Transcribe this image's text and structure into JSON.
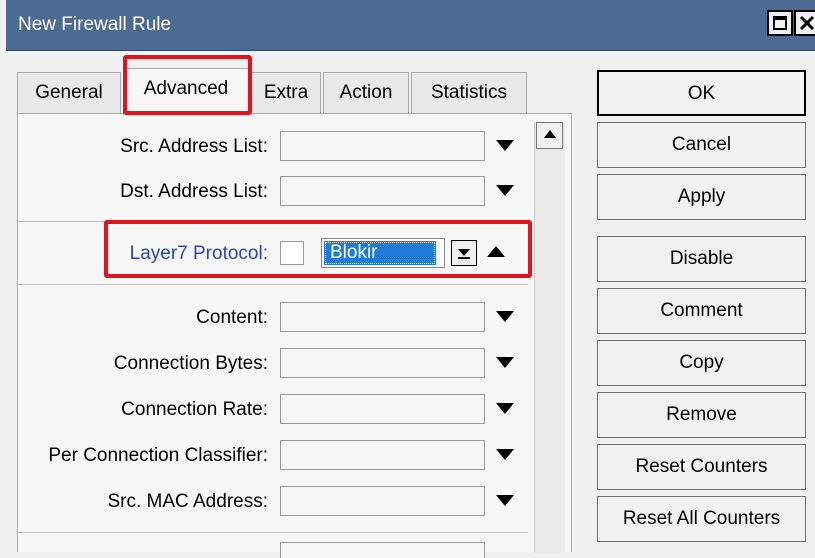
{
  "window": {
    "title": "New Firewall Rule"
  },
  "tabs": [
    {
      "label": "General"
    },
    {
      "label": "Advanced",
      "active": true
    },
    {
      "label": "Extra"
    },
    {
      "label": "Action"
    },
    {
      "label": "Statistics"
    }
  ],
  "fields": {
    "src_address_list": {
      "label": "Src. Address List:",
      "value": ""
    },
    "dst_address_list": {
      "label": "Dst. Address List:",
      "value": ""
    },
    "layer7": {
      "label": "Layer7 Protocol:",
      "value": "Blokir"
    },
    "content": {
      "label": "Content:",
      "value": ""
    },
    "connection_bytes": {
      "label": "Connection Bytes:",
      "value": ""
    },
    "connection_rate": {
      "label": "Connection Rate:",
      "value": ""
    },
    "per_connection_classifier": {
      "label": "Per Connection Classifier:",
      "value": ""
    },
    "src_mac_address": {
      "label": "Src. MAC Address:",
      "value": ""
    }
  },
  "buttons": {
    "ok": "OK",
    "cancel": "Cancel",
    "apply": "Apply",
    "disable": "Disable",
    "comment": "Comment",
    "copy": "Copy",
    "remove": "Remove",
    "reset_counters": "Reset Counters",
    "reset_all_counters": "Reset All Counters"
  },
  "colors": {
    "titlebar": "#4c6b93",
    "highlight": "#e0141e",
    "selection": "#1f7ad8",
    "layer7_label": "#2b45b8"
  }
}
